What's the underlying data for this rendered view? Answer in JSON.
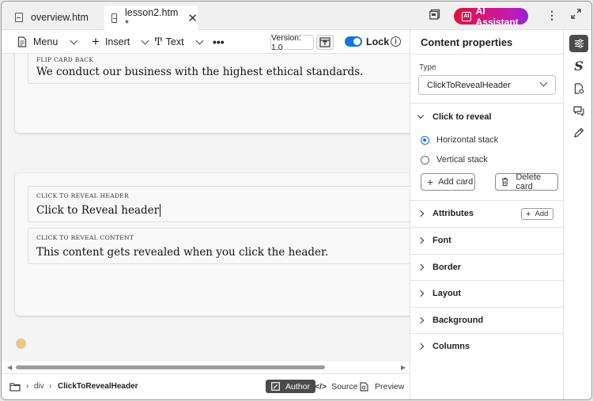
{
  "tabs": [
    {
      "label": "overview.htm"
    },
    {
      "label": "lesson2.htm *"
    }
  ],
  "ai_assistant_label": "AI Assistant",
  "toolbar": {
    "menu_label": "Menu",
    "insert_label": "Insert",
    "text_label": "Text",
    "version_label": "Version: 1.0",
    "lock_label": "Lock",
    "lock_on": true
  },
  "canvas": {
    "card1": {
      "field_label": "FLIP CARD BACK",
      "field_value": "We conduct our business with the highest ethical standards."
    },
    "card2": {
      "header_label": "CLICK TO REVEAL HEADER",
      "header_value": "Click to Reveal header",
      "content_label": "CLICK TO REVEAL CONTENT",
      "content_value": "This content gets revealed when you click the header."
    }
  },
  "statusbar": {
    "crumbs": [
      "div",
      "ClickToRevealHeader"
    ],
    "modes": [
      "Author",
      "Source",
      "Preview"
    ],
    "active_mode": "Author"
  },
  "panel": {
    "title": "Content properties",
    "type_label": "Type",
    "type_value": "ClickToRevealHeader",
    "click_to_reveal": {
      "title": "Click to reveal",
      "options": [
        "Horizontal stack",
        "Vertical stack"
      ],
      "selected": "Horizontal stack",
      "add_card_label": "Add card",
      "delete_card_label": "Delete card"
    },
    "attributes_label": "Attributes",
    "attributes_add_label": "Add",
    "sections": [
      "Font",
      "Border",
      "Layout",
      "Background",
      "Columns"
    ]
  },
  "colors": {
    "accent": "#1473e6",
    "ai_gradient_start": "#e0133a",
    "ai_gradient_end": "#8a27d8",
    "active_dark": "#4b4b4b"
  },
  "icons": {
    "rail": [
      "properties-sliders-icon",
      "styles-s-icon",
      "document-settings-icon",
      "comments-icon",
      "pen-edit-icon"
    ]
  }
}
